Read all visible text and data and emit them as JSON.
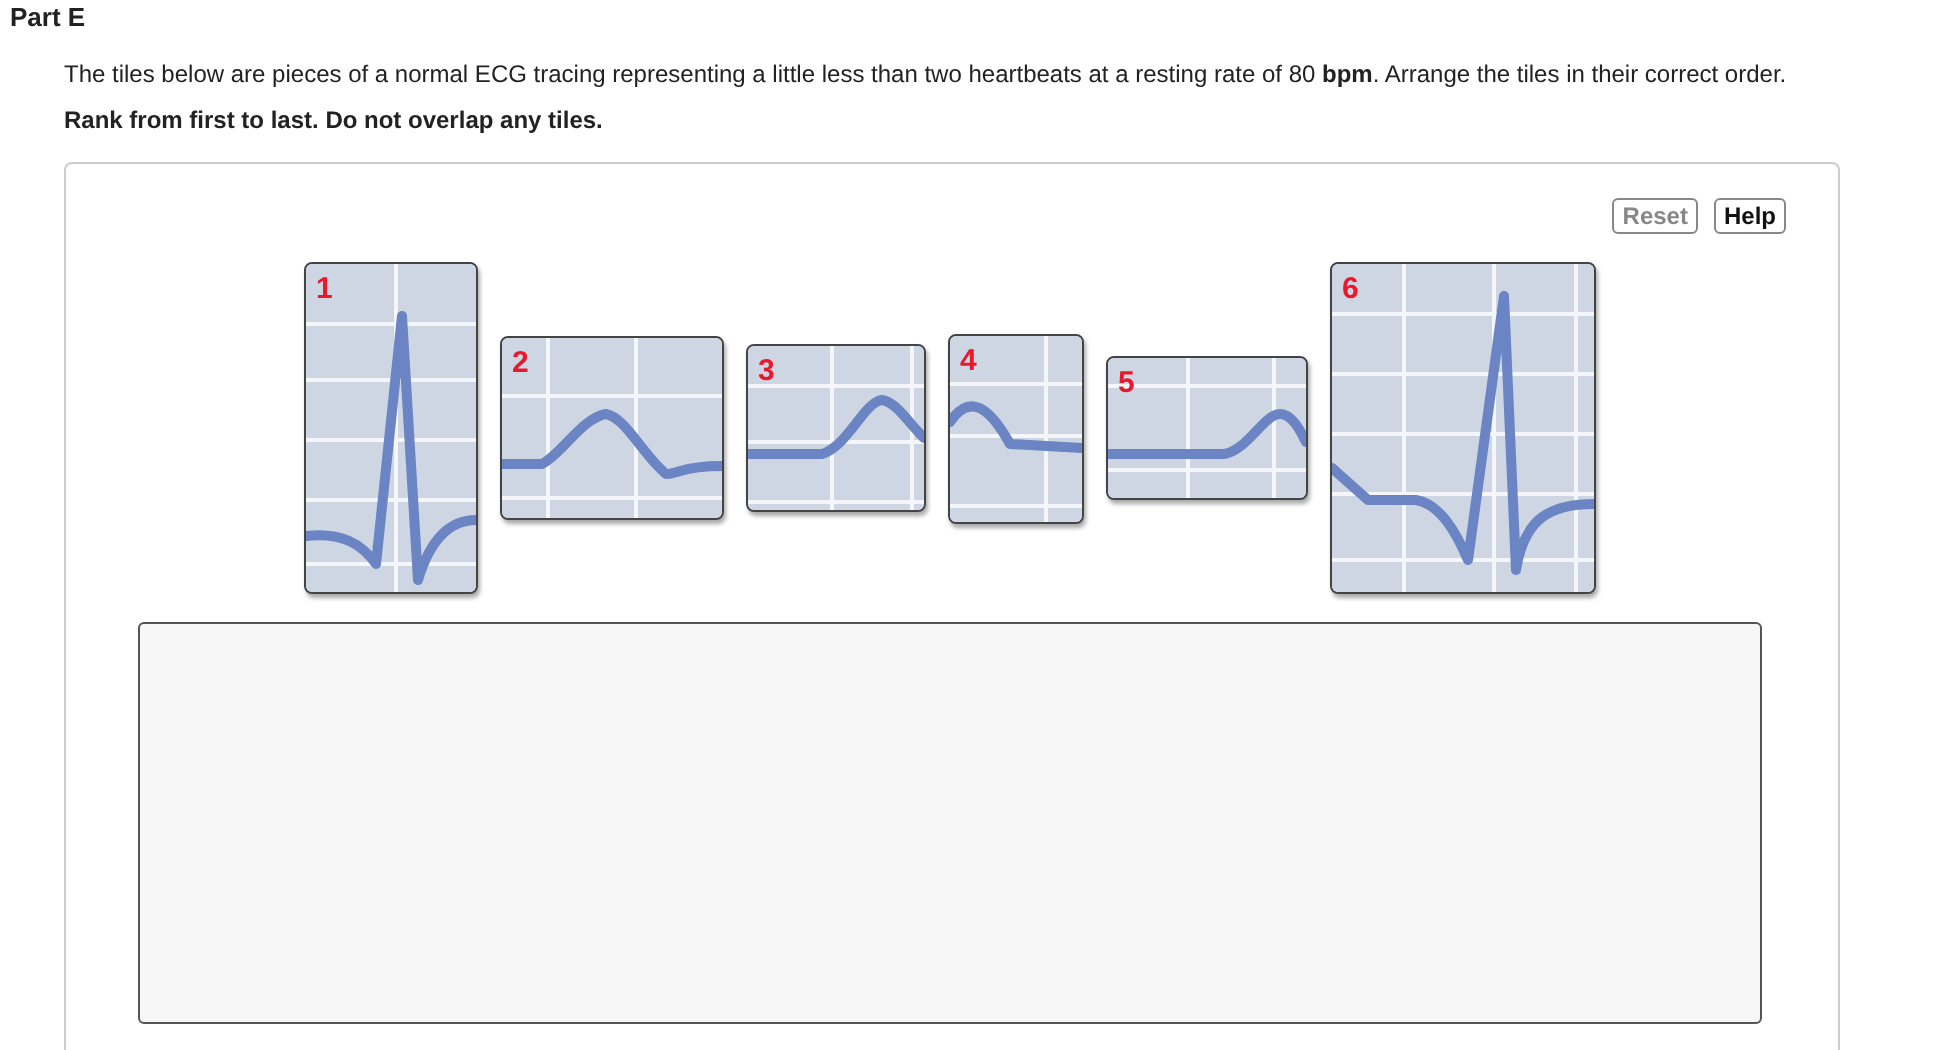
{
  "part_title": "Part E",
  "instructions": "The tiles below are pieces of a normal ECG tracing representing a little less than two heartbeats at a resting rate of 80 **bpm**. Arrange the tiles in their correct order.",
  "rank_note": "Rank from first to last. Do not overlap any tiles.",
  "buttons": [
    {
      "label": "Reset",
      "disabled": true
    },
    {
      "label": "Help",
      "disabled": false
    }
  ],
  "tiles": [
    {
      "label": "1"
    },
    {
      "label": "2"
    },
    {
      "label": "3"
    },
    {
      "label": "4"
    },
    {
      "label": "5"
    },
    {
      "label": "6"
    }
  ]
}
